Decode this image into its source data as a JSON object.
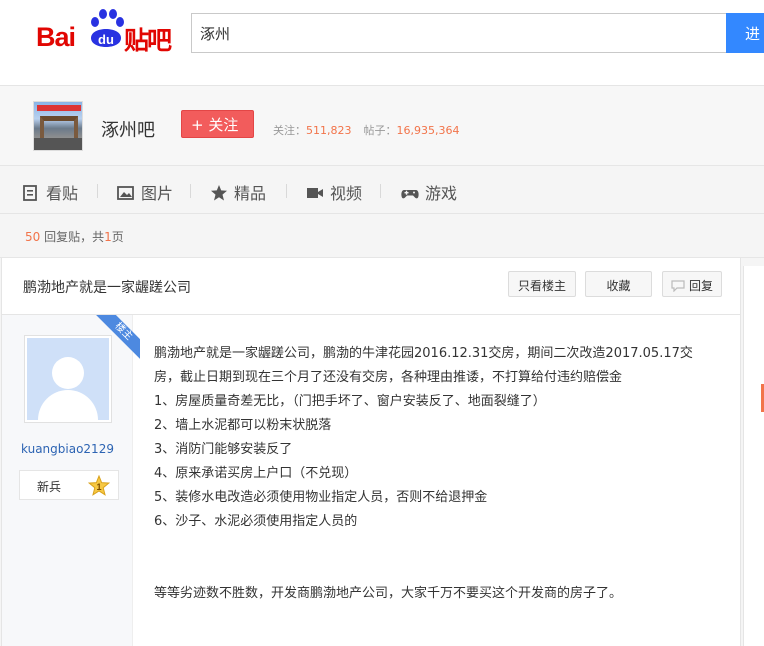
{
  "header": {
    "logo_text_left": "Bai",
    "logo_text_mid": "du",
    "logo_text_right": "贴吧",
    "search_value": "涿州",
    "search_button": "进"
  },
  "forum": {
    "name": "涿州吧",
    "follow_label": "+ 关注",
    "followers_label": "关注：",
    "followers": "511,823",
    "posts_label": "帖子：",
    "posts": "16,935,364",
    "tabs": [
      {
        "label": "看贴",
        "icon": "list-icon"
      },
      {
        "label": "图片",
        "icon": "image-icon"
      },
      {
        "label": "精品",
        "icon": "star-icon"
      },
      {
        "label": "视频",
        "icon": "video-icon"
      },
      {
        "label": "游戏",
        "icon": "gamepad-icon"
      }
    ]
  },
  "thread_info": {
    "reply_count": "50",
    "reply_text": " 回复贴，共",
    "page_count": "1",
    "page_text": "页"
  },
  "thread": {
    "title": "鹏渤地产就是一家龌蹉公司",
    "only_op_label": "只看楼主",
    "favorite_label": "收藏",
    "reply_label": "回复"
  },
  "author": {
    "username": "kuangbiao2129",
    "level_name": "新兵",
    "level_num": "1",
    "badge": "楼主"
  },
  "post": {
    "lines": [
      "鹏渤地产就是一家龌蹉公司，鹏渤的牛津花园2016.12.31交房，期间二次改造2017.05.17交",
      "房，截止日期到现在三个月了还没有交房，各种理由推诿，不打算给付违约赔偿金",
      "1、房屋质量奇差无比，（门把手坏了、窗户安装反了、地面裂缝了）",
      "2、墙上水泥都可以粉末状脱落",
      "3、消防门能够安装反了",
      "4、原来承诺买房上户口（不兑现）",
      "5、装修水电改造必须使用物业指定人员，否则不给退押金",
      "6、沙子、水泥必须使用指定人员的",
      "等等劣迹数不胜数，开发商鹏渤地产公司，大家千万不要买这个开发商的房子了。"
    ]
  },
  "colors": {
    "brand_red": "#e10602",
    "brand_blue": "#2932e1",
    "search_blue": "#3388ff",
    "follow_red": "#f25c5c",
    "accent_orange": "#f2744a",
    "link_blue": "#2d64b3"
  }
}
